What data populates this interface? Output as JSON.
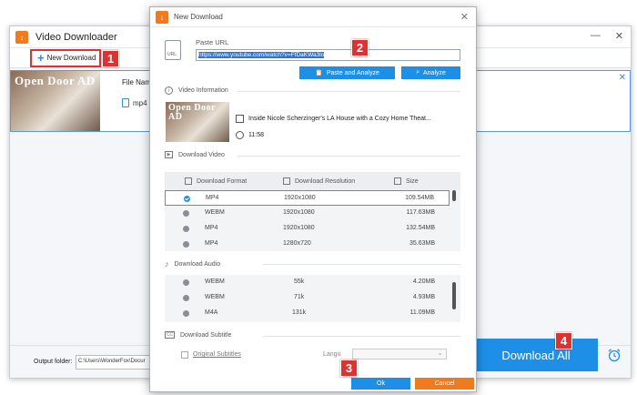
{
  "main": {
    "title": "Video Downloader",
    "new_download_label": "New Download",
    "task": {
      "thumb_text": "Open Door AD",
      "filename_label": "File Nam",
      "format": "mp4"
    },
    "output_label": "Output folder:",
    "output_path": "C:\\Users\\WonderFox\\Docur",
    "download_all_label": "Download All"
  },
  "dialog": {
    "title": "New Download",
    "url_icon_label": "URL",
    "paste_url_label": "Paste URL",
    "url_value": "https://www.youtube.com/watch?v=FfDaKWa3lo",
    "paste_analyze_label": "Paste and Analyze",
    "analyze_label": "Analyze",
    "video_info_label": "Video Information",
    "video": {
      "thumb_text": "Open Door AD",
      "title": "Inside Nicole Scherzinger's LA House with a Cozy Home Theat...",
      "duration": "11:58"
    },
    "download_video_label": "Download Video",
    "video_headers": {
      "format": "Download Format",
      "resolution": "Download Resolution",
      "size": "Size"
    },
    "video_rows": [
      {
        "format": "MP4",
        "resolution": "1920x1080",
        "size": "109.54MB"
      },
      {
        "format": "WEBM",
        "resolution": "1920x1080",
        "size": "117.63MB"
      },
      {
        "format": "MP4",
        "resolution": "1920x1080",
        "size": "132.54MB"
      },
      {
        "format": "MP4",
        "resolution": "1280x720",
        "size": "35.63MB"
      }
    ],
    "download_audio_label": "Download Audio",
    "audio_rows": [
      {
        "format": "WEBM",
        "bitrate": "55k",
        "size": "4.20MB"
      },
      {
        "format": "WEBM",
        "bitrate": "71k",
        "size": "4.93MB"
      },
      {
        "format": "M4A",
        "bitrate": "131k",
        "size": "11.09MB"
      }
    ],
    "download_subtitle_label": "Download Subtitle",
    "original_subtitles_label": "Original Subtitles",
    "language_label": "Langu",
    "ok_label": "Ok",
    "cancel_label": "Cancel"
  },
  "callouts": [
    "1",
    "2",
    "3",
    "4"
  ],
  "colors": {
    "accent_blue": "#1e8fe6",
    "accent_orange": "#f07b1f",
    "callout_red": "#e03131"
  }
}
